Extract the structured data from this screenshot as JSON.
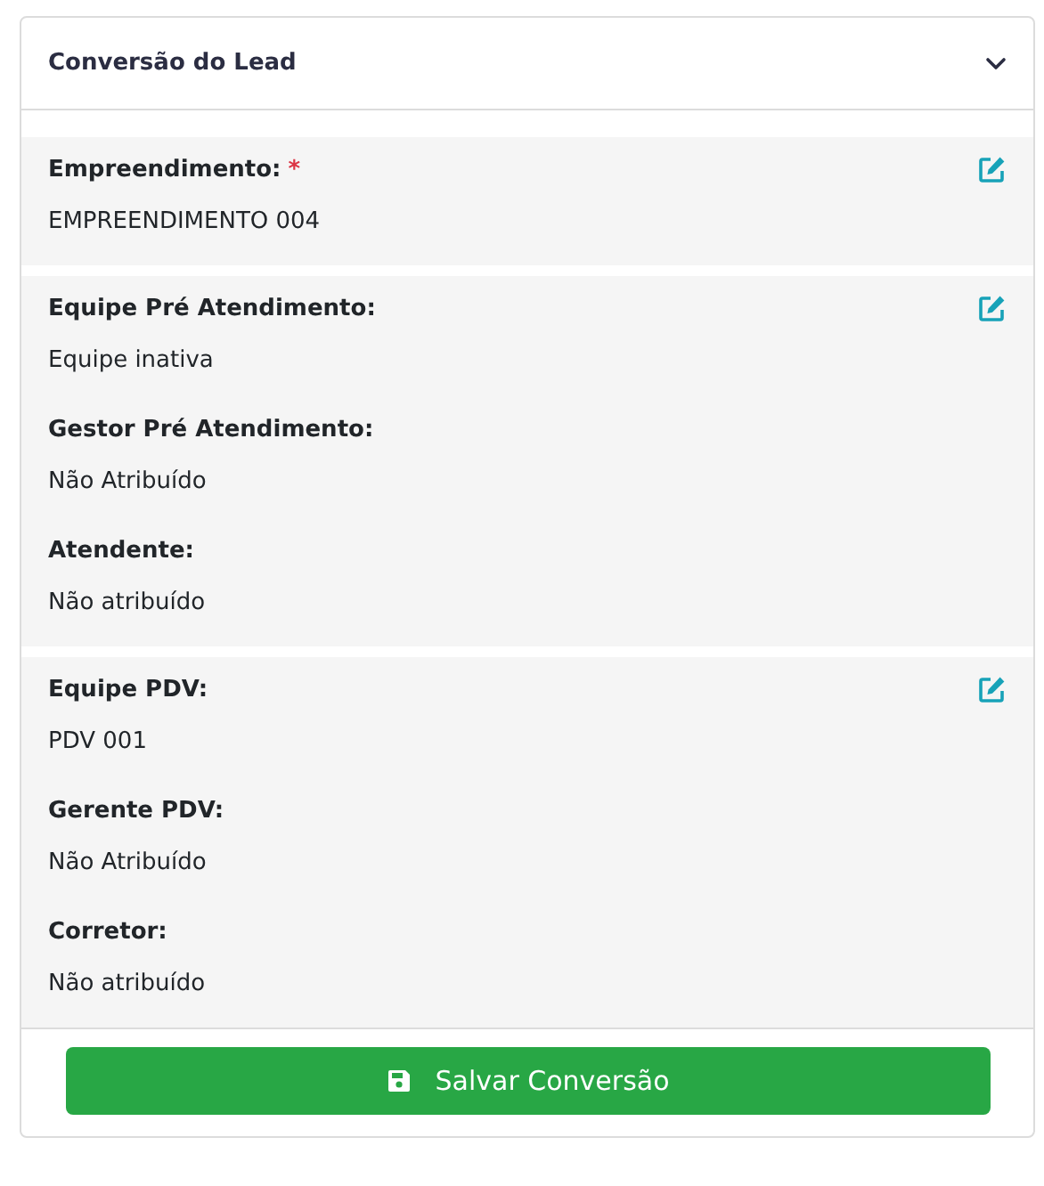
{
  "card": {
    "title": "Conversão do Lead",
    "expanded": true
  },
  "sections": [
    {
      "editable": true,
      "fields": [
        {
          "label": "Empreendimento:",
          "required_mark": "*",
          "value": "EMPREENDIMENTO 004"
        }
      ]
    },
    {
      "editable": true,
      "fields": [
        {
          "label": "Equipe Pré Atendimento:",
          "value": "Equipe inativa"
        },
        {
          "label": "Gestor Pré Atendimento:",
          "value": "Não Atribuído"
        },
        {
          "label": "Atendente:",
          "value": "Não atribuído"
        }
      ]
    },
    {
      "editable": true,
      "fields": [
        {
          "label": "Equipe PDV:",
          "value": "PDV 001"
        },
        {
          "label": "Gerente PDV:",
          "value": "Não Atribuído"
        },
        {
          "label": "Corretor:",
          "value": "Não atribuído"
        }
      ]
    }
  ],
  "save_button": {
    "label": "Salvar Conversão"
  }
}
